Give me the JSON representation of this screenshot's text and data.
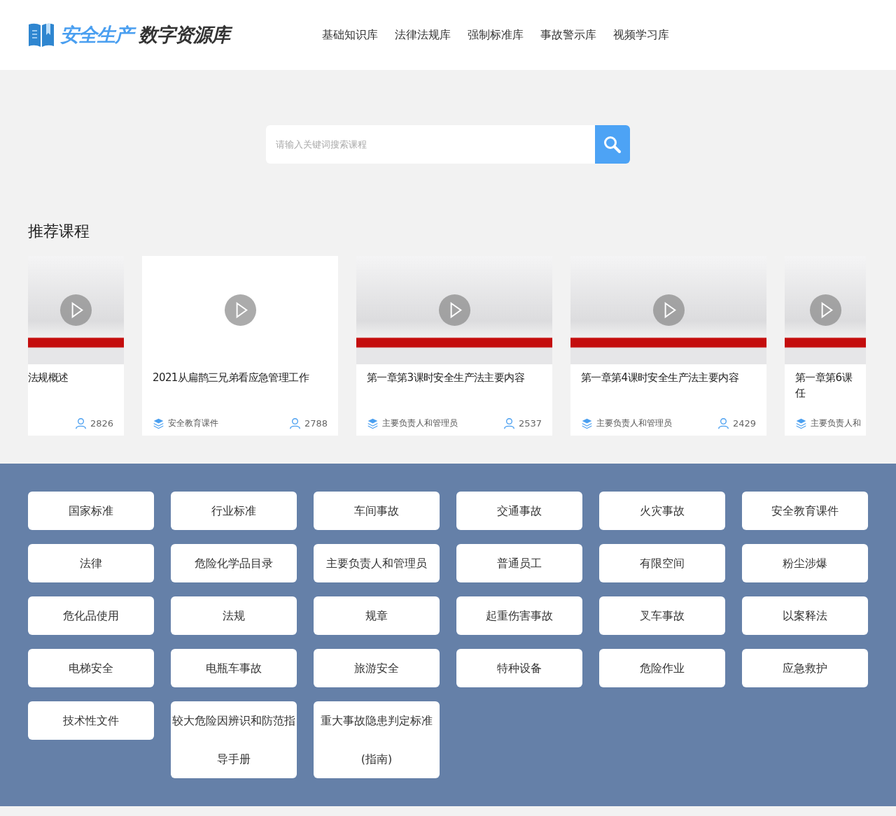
{
  "header": {
    "logo_highlight": "安全生产",
    "logo_rest": "数字资源库",
    "nav": [
      {
        "label": "基础知识库"
      },
      {
        "label": "法律法规库"
      },
      {
        "label": "强制标准库"
      },
      {
        "label": "事故警示库"
      },
      {
        "label": "视频学习库"
      }
    ]
  },
  "search": {
    "placeholder": "请输入关键词搜索课程"
  },
  "recommended": {
    "title": "推荐课程",
    "cards": [
      {
        "kind": "cut_left",
        "thumbnail": true,
        "title_lines": [
          "法规概述"
        ],
        "count": "2826"
      },
      {
        "kind": "full",
        "thumbnail": false,
        "title_lines": [
          "2021从扁鹊三兄弟看应急管理工作"
        ],
        "tag": "安全教育课件",
        "count": "2788"
      },
      {
        "kind": "full",
        "thumbnail": true,
        "title_lines": [
          "第一章第3课时安全生产法主要内容"
        ],
        "tag": "主要负责人和管理员",
        "count": "2537"
      },
      {
        "kind": "full",
        "thumbnail": true,
        "title_lines": [
          "第一章第4课时安全生产法主要内容"
        ],
        "tag": "主要负责人和管理员",
        "count": "2429"
      },
      {
        "kind": "cut_right",
        "thumbnail": true,
        "title_lines": [
          "第一章第6课",
          "任"
        ],
        "tag": "主要负责人和"
      }
    ]
  },
  "categories": [
    "国家标准",
    "行业标准",
    "车间事故",
    "交通事故",
    "火灾事故",
    "安全教育课件",
    "法律",
    "危险化学品目录",
    "主要负责人和管理员",
    "普通员工",
    "有限空间",
    "粉尘涉爆",
    "危化品使用",
    "法规",
    "规章",
    "起重伤害事故",
    "叉车事故",
    "以案释法",
    "电梯安全",
    "电瓶车事故",
    "旅游安全",
    "特种设备",
    "危险作业",
    "应急救护",
    "技术性文件",
    "较大危险因辨识和防范指导手册",
    "重大事故隐患判定标准(指南)"
  ]
}
